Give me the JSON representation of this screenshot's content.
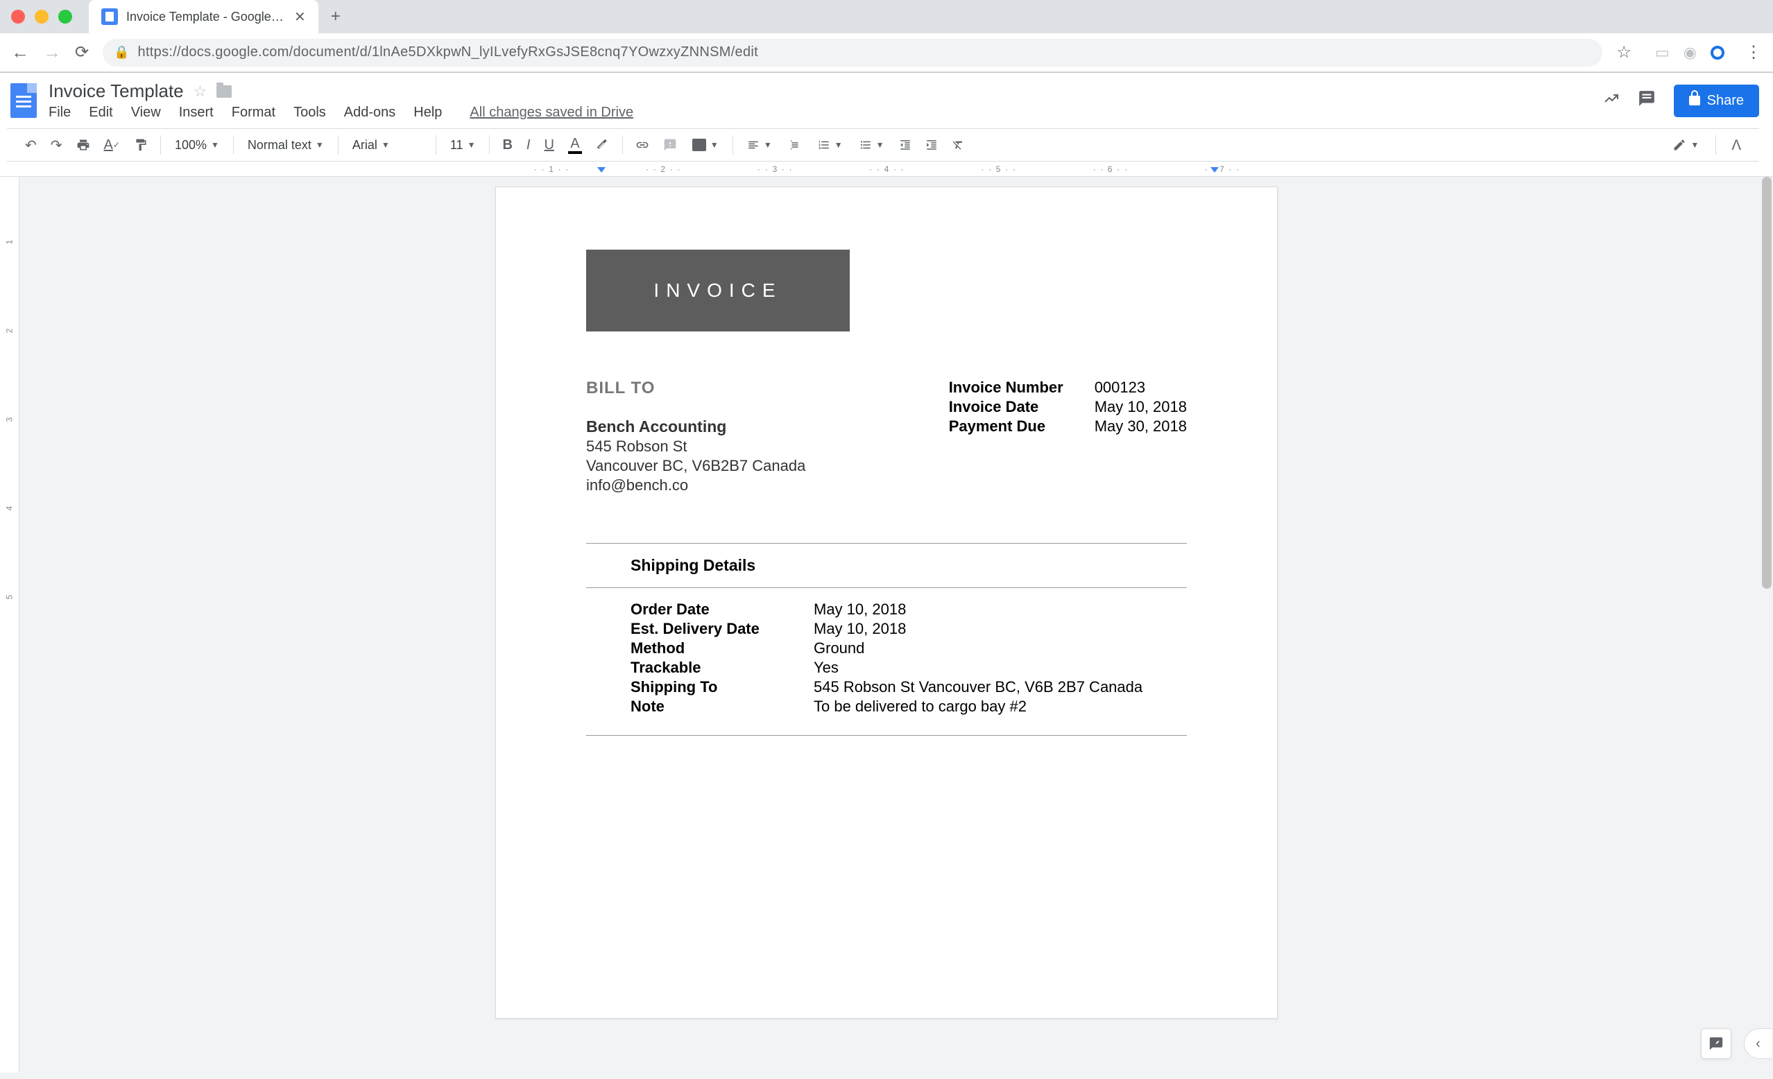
{
  "browser": {
    "tab_title": "Invoice Template - Google Doc",
    "url": "https://docs.google.com/document/d/1lnAe5DXkpwN_lyILvefyRxGsJSE8cnq7YOwzxyZNNSM/edit"
  },
  "docs": {
    "title": "Invoice Template",
    "menus": [
      "File",
      "Edit",
      "View",
      "Insert",
      "Format",
      "Tools",
      "Add-ons",
      "Help"
    ],
    "save_status": "All changes saved in Drive",
    "share_label": "Share"
  },
  "toolbar": {
    "zoom": "100%",
    "style": "Normal text",
    "font": "Arial",
    "font_size": "11"
  },
  "ruler": {
    "marks": [
      "1",
      "2",
      "3",
      "4",
      "5",
      "6",
      "7"
    ]
  },
  "vruler": [
    "1",
    "2",
    "3",
    "4",
    "5"
  ],
  "invoice": {
    "banner": "INVOICE",
    "bill_to_label": "BILL TO",
    "bill_name": "Bench Accounting",
    "bill_street": "545 Robson St",
    "bill_city": "Vancouver BC, V6B2B7 Canada",
    "bill_email": "info@bench.co",
    "meta": {
      "number_label": "Invoice Number",
      "number_value": "000123",
      "date_label": "Invoice Date",
      "date_value": "May 10, 2018",
      "due_label": "Payment Due",
      "due_value": "May 30, 2018"
    },
    "ship": {
      "title": "Shipping Details",
      "order_date_label": "Order Date",
      "order_date_value": "May 10, 2018",
      "delivery_label": "Est. Delivery Date",
      "delivery_value": "May 10, 2018",
      "method_label": "Method",
      "method_value": "Ground",
      "trackable_label": "Trackable",
      "trackable_value": "Yes",
      "to_label": "Shipping To",
      "to_value": "545 Robson St Vancouver BC, V6B 2B7 Canada",
      "note_label": "Note",
      "note_value": "To be delivered to cargo bay #2"
    }
  }
}
